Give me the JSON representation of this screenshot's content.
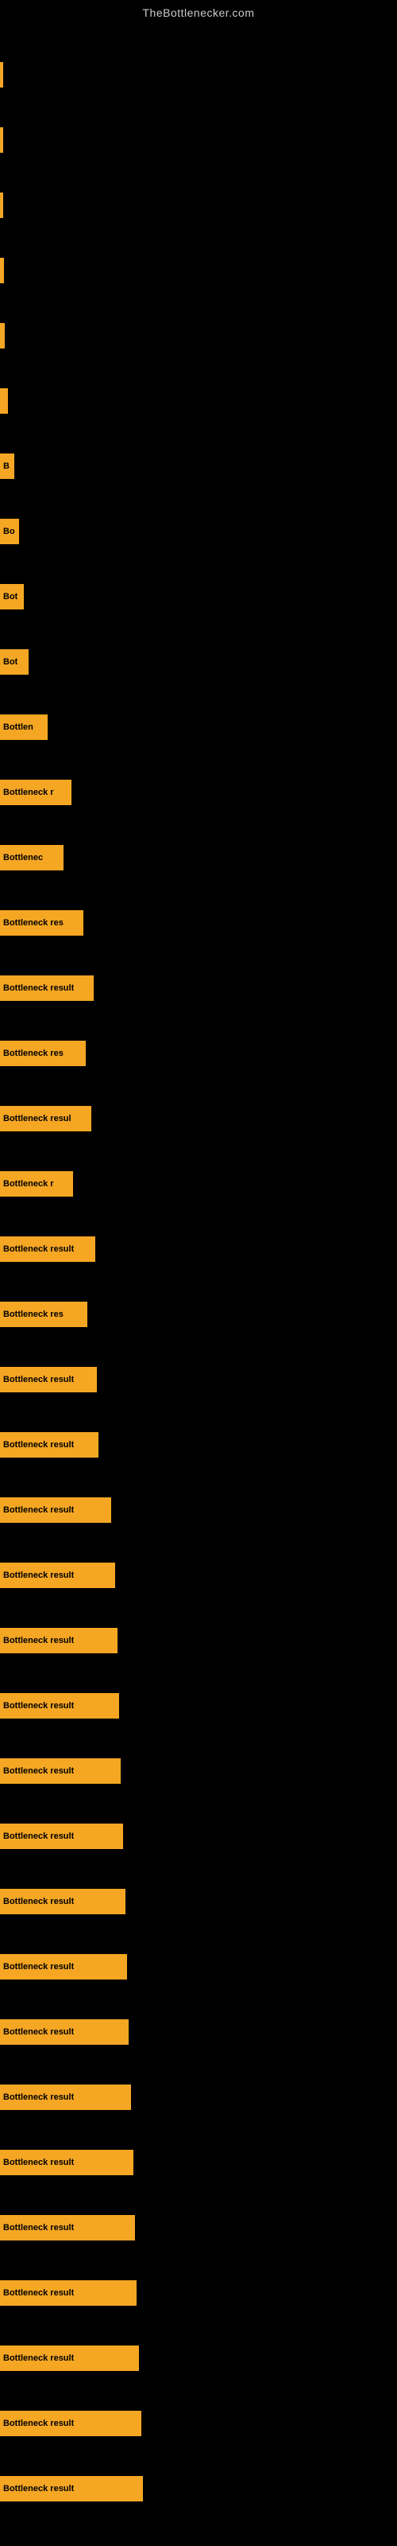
{
  "site": {
    "title": "TheBottlenecker.com"
  },
  "bars": [
    {
      "label": "",
      "width": 2,
      "text": ""
    },
    {
      "label": "",
      "width": 3,
      "text": ""
    },
    {
      "label": "",
      "width": 4,
      "text": ""
    },
    {
      "label": "",
      "width": 5,
      "text": ""
    },
    {
      "label": "",
      "width": 6,
      "text": ""
    },
    {
      "label": "",
      "width": 10,
      "text": ""
    },
    {
      "label": "B",
      "width": 18,
      "text": "B"
    },
    {
      "label": "Bo",
      "width": 24,
      "text": "Bo"
    },
    {
      "label": "Bot",
      "width": 30,
      "text": "Bot"
    },
    {
      "label": "Bot",
      "width": 36,
      "text": "Bot"
    },
    {
      "label": "Bottlen",
      "width": 60,
      "text": "Bottlen"
    },
    {
      "label": "Bottleneck r",
      "width": 90,
      "text": "Bottleneck r"
    },
    {
      "label": "Bottlenec",
      "width": 80,
      "text": "Bottlenec"
    },
    {
      "label": "Bottleneck res",
      "width": 105,
      "text": "Bottleneck res"
    },
    {
      "label": "Bottleneck result",
      "width": 118,
      "text": "Bottleneck result"
    },
    {
      "label": "Bottleneck res",
      "width": 108,
      "text": "Bottleneck res"
    },
    {
      "label": "Bottleneck resul",
      "width": 115,
      "text": "Bottleneck resul"
    },
    {
      "label": "Bottleneck r",
      "width": 92,
      "text": "Bottleneck r"
    },
    {
      "label": "Bottleneck result",
      "width": 120,
      "text": "Bottleneck result"
    },
    {
      "label": "Bottleneck res",
      "width": 110,
      "text": "Bottleneck res"
    },
    {
      "label": "Bottleneck result",
      "width": 122,
      "text": "Bottleneck result"
    },
    {
      "label": "Bottleneck result",
      "width": 124,
      "text": "Bottleneck result"
    },
    {
      "label": "Bottleneck result",
      "width": 140,
      "text": "Bottleneck result"
    },
    {
      "label": "Bottleneck result",
      "width": 145,
      "text": "Bottleneck result"
    },
    {
      "label": "Bottleneck result",
      "width": 148,
      "text": "Bottleneck result"
    },
    {
      "label": "Bottleneck result",
      "width": 150,
      "text": "Bottleneck result"
    },
    {
      "label": "Bottleneck result",
      "width": 152,
      "text": "Bottleneck result"
    },
    {
      "label": "Bottleneck result",
      "width": 155,
      "text": "Bottleneck result"
    },
    {
      "label": "Bottleneck result",
      "width": 158,
      "text": "Bottleneck result"
    },
    {
      "label": "Bottleneck result",
      "width": 160,
      "text": "Bottleneck result"
    },
    {
      "label": "Bottleneck result",
      "width": 162,
      "text": "Bottleneck result"
    },
    {
      "label": "Bottleneck result",
      "width": 165,
      "text": "Bottleneck result"
    },
    {
      "label": "Bottleneck result",
      "width": 168,
      "text": "Bottleneck result"
    },
    {
      "label": "Bottleneck result",
      "width": 170,
      "text": "Bottleneck result"
    },
    {
      "label": "Bottleneck result",
      "width": 172,
      "text": "Bottleneck result"
    },
    {
      "label": "Bottleneck result",
      "width": 175,
      "text": "Bottleneck result"
    },
    {
      "label": "Bottleneck result",
      "width": 178,
      "text": "Bottleneck result"
    },
    {
      "label": "Bottleneck result",
      "width": 180,
      "text": "Bottleneck result"
    }
  ]
}
